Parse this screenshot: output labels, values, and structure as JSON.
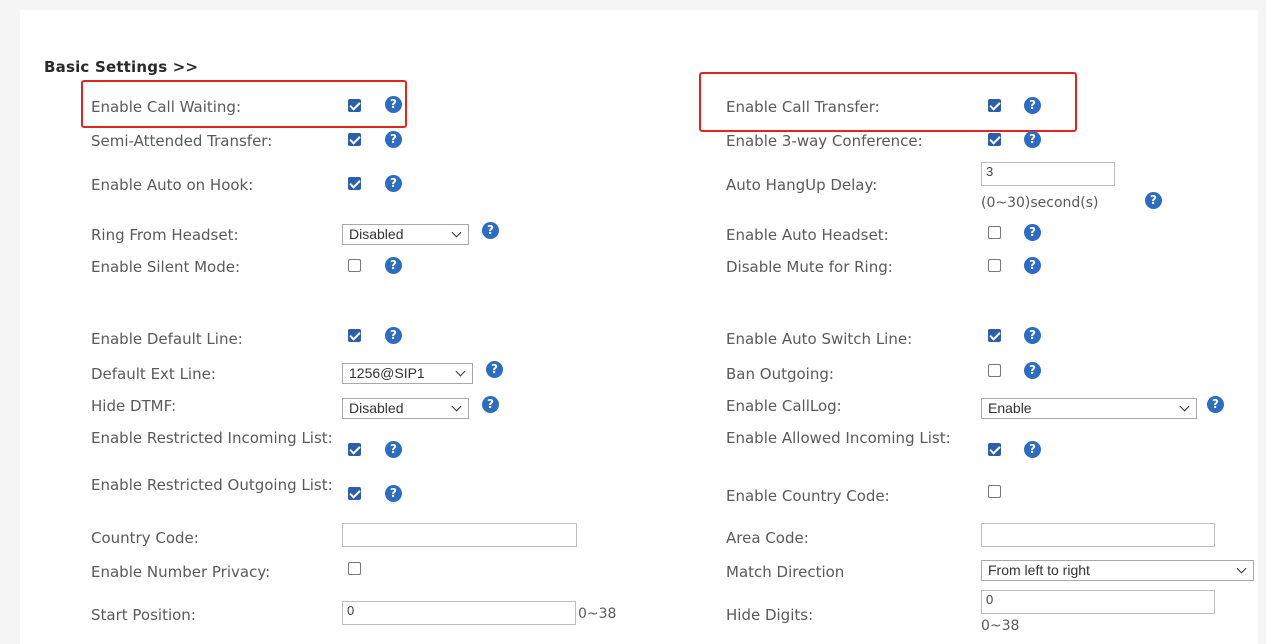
{
  "section_title": "Basic Settings >>",
  "help_glyph": "?",
  "colors": {
    "checkbox_checked": "#2d5ea8",
    "help_icon": "#2d6cc0",
    "highlight": "#e0261f"
  },
  "left": {
    "call_waiting": {
      "label": "Enable Call Waiting:",
      "checked": true
    },
    "semi_attended": {
      "label": "Semi-Attended Transfer:",
      "checked": true
    },
    "auto_on_hook": {
      "label": "Enable Auto on Hook:",
      "checked": true
    },
    "ring_from_headset": {
      "label": "Ring From Headset:",
      "value": "Disabled"
    },
    "silent_mode": {
      "label": "Enable Silent Mode:",
      "checked": false
    },
    "default_line": {
      "label": "Enable Default Line:",
      "checked": true
    },
    "default_ext_line": {
      "label": "Default Ext Line:",
      "value": "1256@SIP1"
    },
    "hide_dtmf": {
      "label": "Hide DTMF:",
      "value": "Disabled"
    },
    "restricted_incoming": {
      "label": "Enable Restricted Incoming List:",
      "checked": true
    },
    "restricted_outgoing": {
      "label": "Enable Restricted Outgoing List:",
      "checked": true
    },
    "country_code": {
      "label": "Country Code:",
      "value": ""
    },
    "number_privacy": {
      "label": "Enable Number Privacy:",
      "checked": false
    },
    "start_position": {
      "label": "Start Position:",
      "value": "0",
      "range": "0~38"
    }
  },
  "right": {
    "call_transfer": {
      "label": "Enable Call Transfer:",
      "checked": true
    },
    "three_way": {
      "label": "Enable 3-way Conference:",
      "checked": true
    },
    "auto_hangup": {
      "label": "Auto HangUp Delay:",
      "value": "3",
      "hint": "(0~30)second(s)"
    },
    "auto_headset": {
      "label": "Enable Auto Headset:",
      "checked": false
    },
    "mute_for_ring": {
      "label": "Disable Mute for Ring:",
      "checked": false
    },
    "auto_switch_line": {
      "label": "Enable Auto Switch Line:",
      "checked": true
    },
    "ban_outgoing": {
      "label": "Ban Outgoing:",
      "checked": false
    },
    "call_log": {
      "label": "Enable CallLog:",
      "value": "Enable"
    },
    "allowed_incoming": {
      "label": "Enable Allowed Incoming List:",
      "checked": true
    },
    "country_code_enable": {
      "label": "Enable Country Code:",
      "checked": false
    },
    "area_code": {
      "label": "Area Code:",
      "value": ""
    },
    "match_direction": {
      "label": "Match Direction",
      "value": "From left to right"
    },
    "hide_digits": {
      "label": "Hide Digits:",
      "value": "0",
      "range": "0~38"
    }
  }
}
